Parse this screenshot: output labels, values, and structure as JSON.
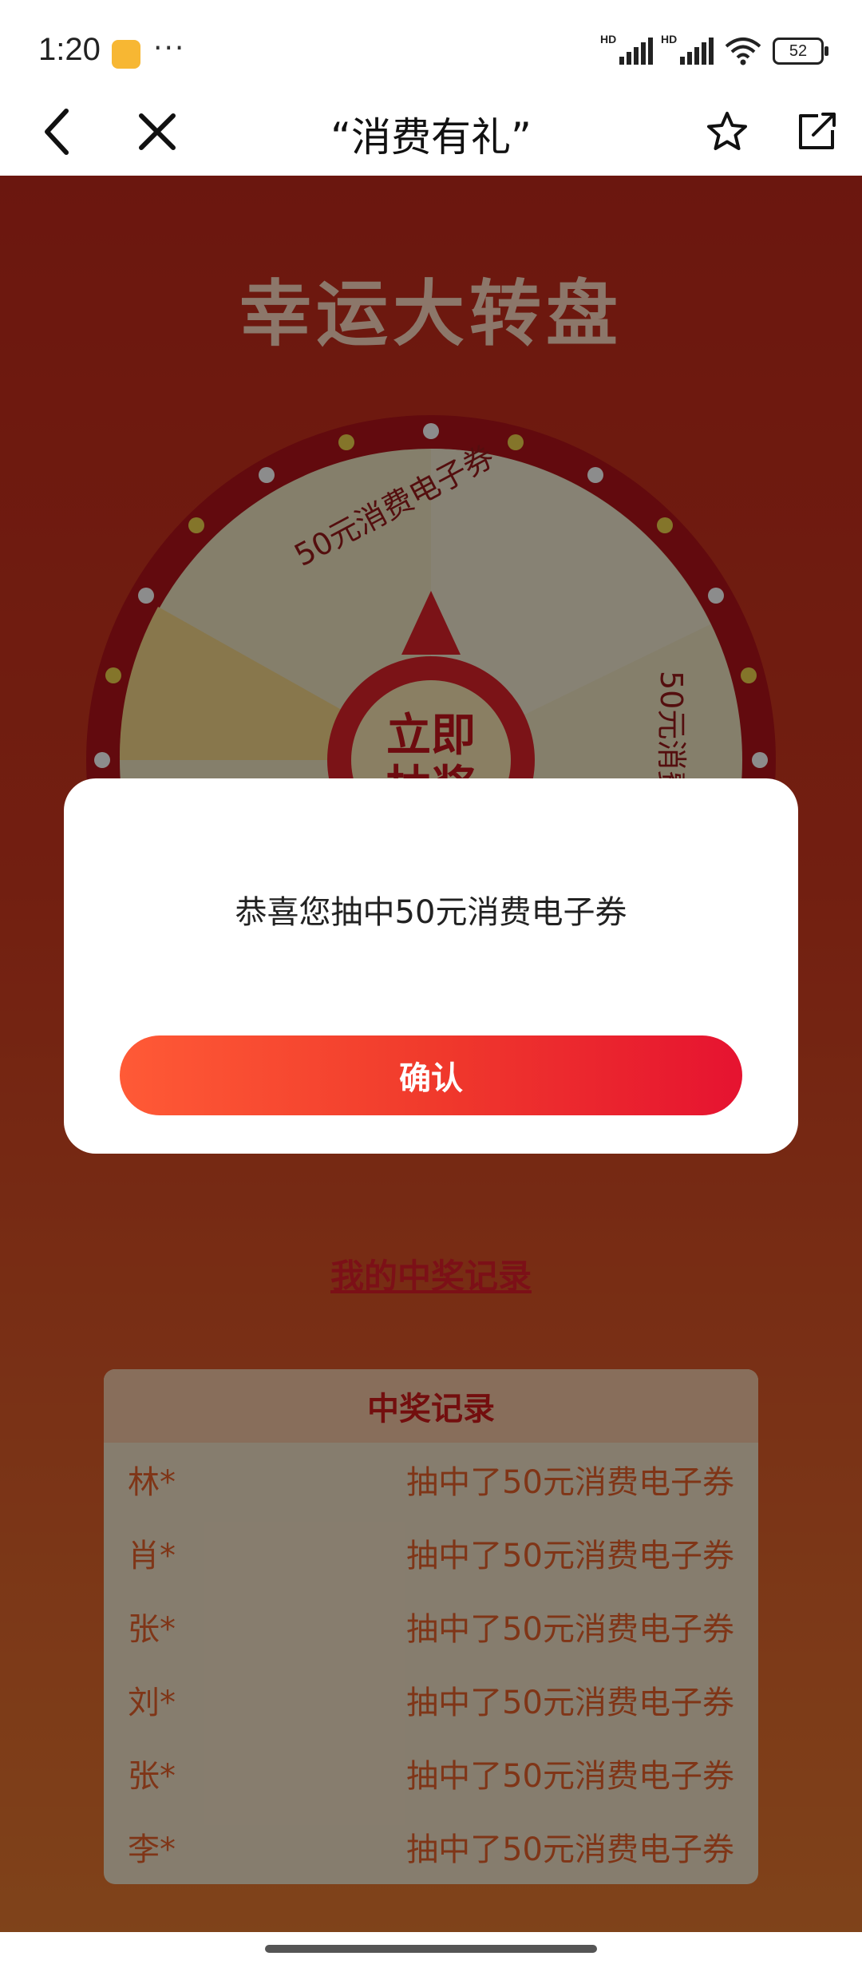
{
  "status_bar": {
    "time": "1:20",
    "signal_1_label": "HD",
    "signal_2_label": "HD",
    "battery": "52"
  },
  "nav": {
    "title": "“消费有礼”",
    "back_icon": "chevron-left-icon",
    "close_icon": "close-icon",
    "favorite_icon": "star-icon",
    "share_icon": "share-icon"
  },
  "page": {
    "title": "幸运大转盘",
    "wheel_segment_1": "50元消费电子券",
    "wheel_segment_2": "50元消费电子券",
    "wheel_center_line1": "立即",
    "wheel_center_line2": "抽奖",
    "my_records_link": "我的中奖记录"
  },
  "records": {
    "title": "中奖记录",
    "rows": [
      {
        "name": "林*",
        "text": "抽中了50元消费电子券"
      },
      {
        "name": "肖*",
        "text": "抽中了50元消费电子券"
      },
      {
        "name": "张*",
        "text": "抽中了50元消费电子券"
      },
      {
        "name": "刘*",
        "text": "抽中了50元消费电子券"
      },
      {
        "name": "张*",
        "text": "抽中了50元消费电子券"
      },
      {
        "name": "李*",
        "text": "抽中了50元消费电子券"
      }
    ]
  },
  "modal": {
    "message": "恭喜您抽中50元消费电子券",
    "confirm_label": "确认"
  },
  "colors": {
    "accent_start": "#ff5a36",
    "accent_end": "#e61330",
    "page_bg": "#c42a1c"
  }
}
